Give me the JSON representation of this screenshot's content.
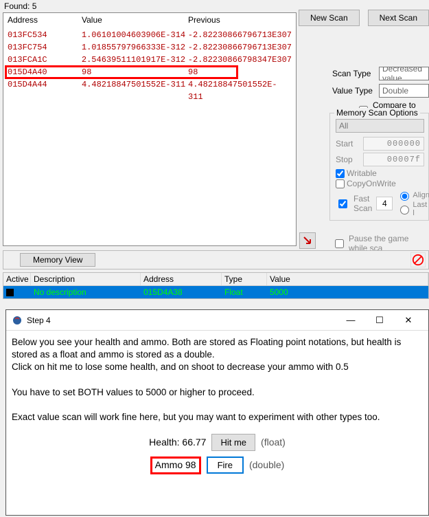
{
  "found_label": "Found: 5",
  "results": {
    "headers": {
      "address": "Address",
      "value": "Value",
      "previous": "Previous"
    },
    "rows": [
      {
        "address": "013FC534",
        "value": "1.06101004603906E-314",
        "previous": "-2.82230866796713E307"
      },
      {
        "address": "013FC754",
        "value": "1.01855797966333E-312",
        "previous": "-2.82230866796713E307"
      },
      {
        "address": "013FCA1C",
        "value": "2.54639511101917E-312",
        "previous": "-2.82230866798347E307"
      },
      {
        "address": "015D4A40",
        "value": "98",
        "previous": "98"
      },
      {
        "address": "015D4A44",
        "value": "4.48218847501552E-311",
        "previous": "4.48218847501552E-311"
      }
    ],
    "highlight_index": 3
  },
  "buttons": {
    "new_scan": "New Scan",
    "next_scan": "Next Scan"
  },
  "scan_type": {
    "label": "Scan Type",
    "value": "Decreased value"
  },
  "value_type": {
    "label": "Value Type",
    "value": "Double"
  },
  "compare_first": "Compare to first s",
  "mem_opts": {
    "title": "Memory Scan Options",
    "all": "All",
    "start_label": "Start",
    "start_value": "000000",
    "stop_label": "Stop",
    "stop_value": "00007f",
    "writable": "Writable",
    "copyonwrite": "CopyOnWrite",
    "fastscan": "Fast Scan",
    "fastscan_value": "4",
    "align": "Align",
    "last": "Last l"
  },
  "pause_label": "Pause the game while sca",
  "memory_view": "Memory View",
  "addr_table": {
    "headers": {
      "active": "Active",
      "description": "Description",
      "address": "Address",
      "type": "Type",
      "value": "Value"
    },
    "row": {
      "description": "No description",
      "address": "015D4A38",
      "type": "Float",
      "value": "5000"
    }
  },
  "step": {
    "title": "Step 4",
    "body_p1": "Below you see your health and ammo. Both are stored as Floating point notations, but health is stored as a float and ammo is stored as a double.",
    "body_p2": "Click on hit me to lose some health, and on shoot to decrease your ammo with 0.5",
    "body_p3": "You have to set BOTH values to 5000 or higher to proceed.",
    "body_p4": "Exact value scan will work fine here, but you may want to experiment with other types too.",
    "health_label": "Health: 66.77",
    "hitme": "Hit me",
    "float_hint": "(float)",
    "ammo_label": "Ammo 98",
    "fire": "Fire",
    "double_hint": "(double)"
  }
}
